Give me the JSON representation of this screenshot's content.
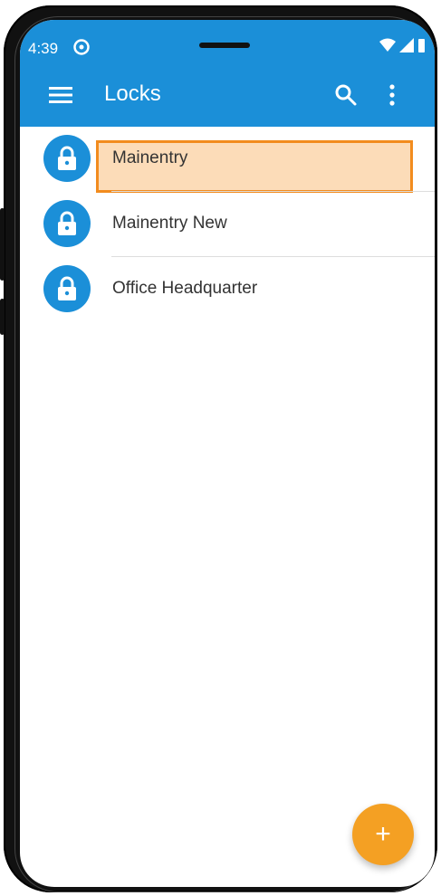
{
  "status_bar": {
    "time": "4:39"
  },
  "app_bar": {
    "title": "Locks"
  },
  "locks": [
    {
      "name": "Mainentry",
      "selected": true
    },
    {
      "name": "Mainentry New",
      "selected": false
    },
    {
      "name": "Office Headquarter",
      "selected": false
    }
  ],
  "fab": {
    "label": "+"
  },
  "colors": {
    "primary": "#1b8fd8",
    "accent": "#f4a023",
    "highlight_fill": "#fcdcb8",
    "highlight_border": "#f28c1e"
  }
}
